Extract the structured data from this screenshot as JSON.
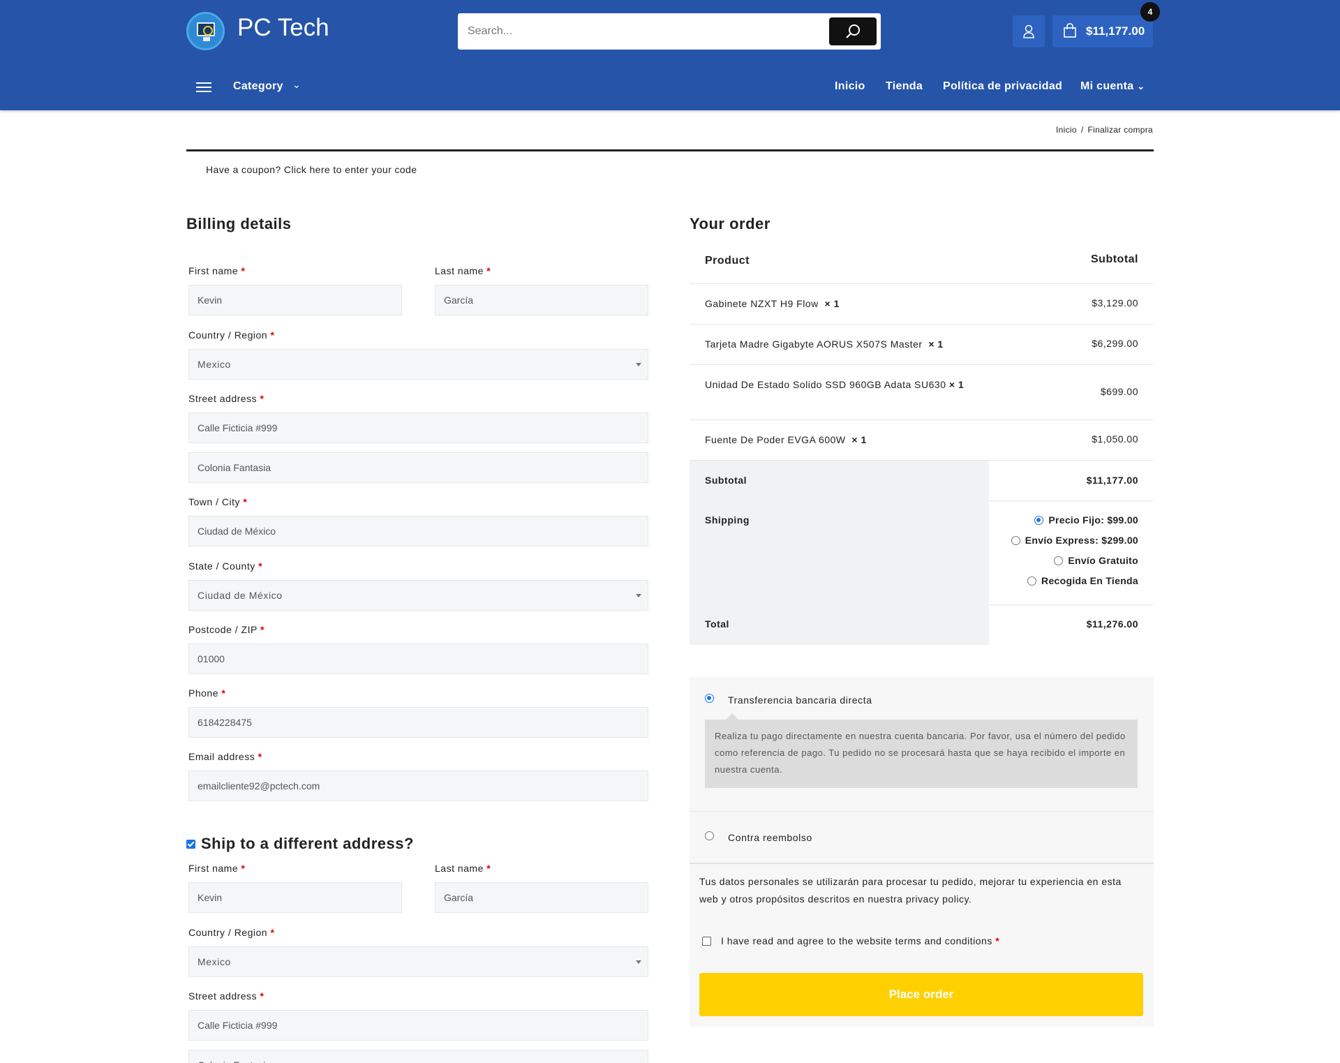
{
  "header": {
    "logo_text": "PC Tech",
    "search_placeholder": "Search...",
    "cart_total": "$11,177.00",
    "cart_count": "4",
    "brand_color": "#2554a9"
  },
  "nav": {
    "category_label": "Category",
    "links": [
      "Inicio",
      "Tienda",
      "Política de privacidad",
      "Mi cuenta"
    ]
  },
  "breadcrumb": [
    "Inicio",
    "Finalizar compra"
  ],
  "coupon_text": "Have a coupon? Click here to enter your code",
  "billing": {
    "title": "Billing details",
    "first_name_label": "First name",
    "first_name": "Kevin",
    "last_name_label": "Last name",
    "last_name": "García",
    "country_label": "Country / Region",
    "country": "Mexico",
    "street_label": "Street address",
    "street1": "Calle Ficticia #999",
    "street2": "Colonia Fantasia",
    "city_label": "Town / City",
    "city": "Ciudad de México",
    "state_label": "State / County",
    "state": "Ciudad de México",
    "postcode_label": "Postcode / ZIP",
    "postcode": "01000",
    "phone_label": "Phone",
    "phone": "6184228475",
    "email_label": "Email address",
    "email": "emailcliente92@pctech.com",
    "required_mark": "*"
  },
  "shipping": {
    "title": "Ship to a different address?",
    "checked": true,
    "first_name_label": "First name",
    "first_name": "Kevin",
    "last_name_label": "Last name",
    "last_name": "García",
    "country_label": "Country / Region",
    "country": "Mexico",
    "street_label": "Street address",
    "street1": "Calle Ficticia #999",
    "street2": "Colonia Fantasia"
  },
  "order": {
    "title": "Your order",
    "col_product": "Product",
    "col_subtotal": "Subtotal",
    "items": [
      {
        "name": "Gabinete NZXT H9 Flow",
        "qty": "× 1",
        "price": "$3,129.00"
      },
      {
        "name": "Tarjeta Madre Gigabyte AORUS X507S Master",
        "qty": "× 1",
        "price": "$6,299.00"
      },
      {
        "name": "Unidad De Estado Solido SSD 960GB Adata SU630",
        "qty": "× 1",
        "price": "$699.00"
      },
      {
        "name": "Fuente De Poder EVGA 600W",
        "qty": "× 1",
        "price": "$1,050.00"
      }
    ],
    "subtotal_label": "Subtotal",
    "subtotal": "$11,177.00",
    "shipping_label": "Shipping",
    "shipping_options": [
      {
        "label": "Precio Fijo: $99.00",
        "selected": true
      },
      {
        "label": "Envío Express: $299.00",
        "selected": false
      },
      {
        "label": "Envío Gratuito",
        "selected": false
      },
      {
        "label": "Recogida En Tienda",
        "selected": false
      }
    ],
    "total_label": "Total",
    "total": "$11,276.00"
  },
  "payment": {
    "methods": [
      {
        "label": "Transferencia bancaria directa",
        "selected": true
      },
      {
        "label": "Contra reembolso",
        "selected": false
      }
    ],
    "bank_description": "Realiza tu pago directamente en nuestra cuenta bancaria. Por favor, usa el número del pedido como referencia de pago. Tu pedido no se procesará hasta que se haya recibido el importe en nuestra cuenta.",
    "privacy_text": "Tus datos personales se utilizarán para procesar tu pedido, mejorar tu experiencia en esta web y otros propósitos descritos en nuestra privacy policy.",
    "terms_text": "I have read and agree to the website terms and conditions",
    "place_order": "Place order",
    "button_color": "#ffd000"
  }
}
